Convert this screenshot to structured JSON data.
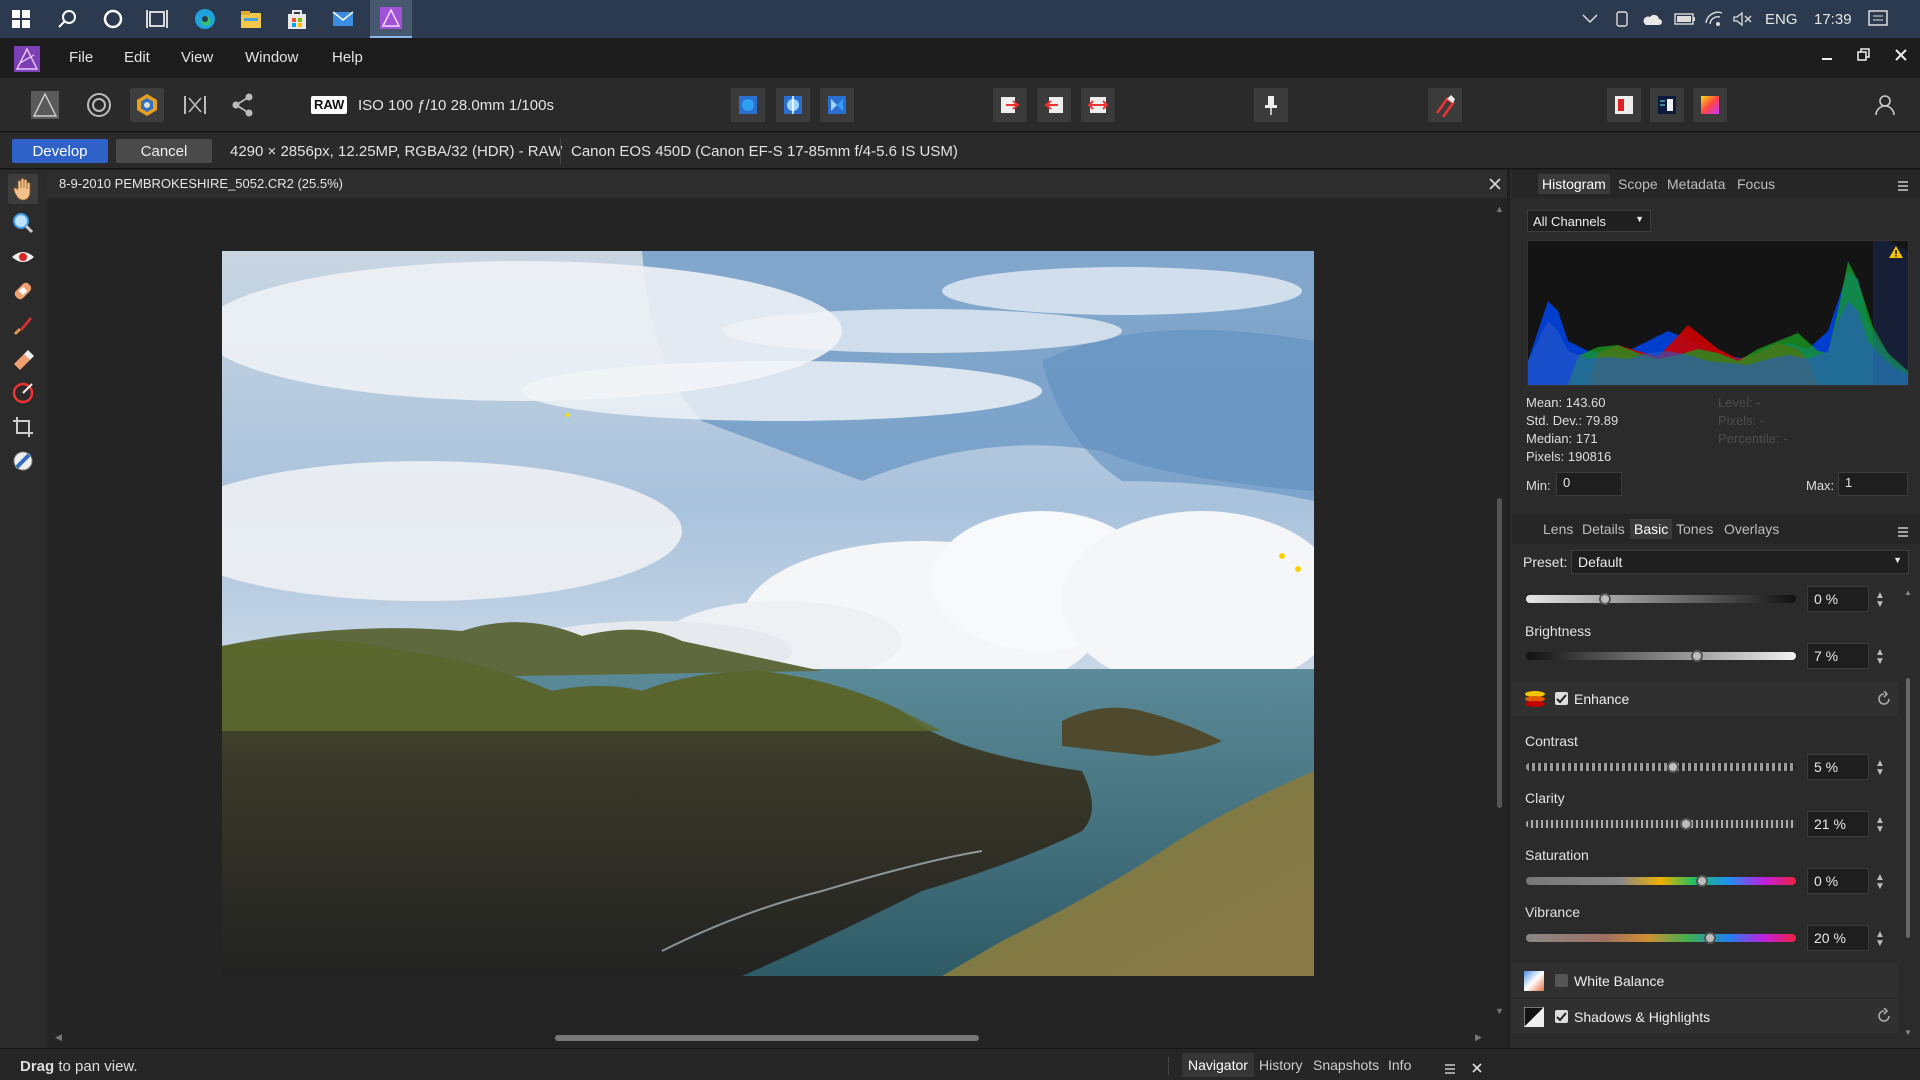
{
  "taskbar": {
    "language": "ENG",
    "time": "17:39"
  },
  "menu": {
    "items": [
      "File",
      "Edit",
      "View",
      "Window",
      "Help"
    ]
  },
  "toolbar": {
    "raw_badge": "RAW",
    "exif": "ISO 100 ƒ/10 28.0mm 1/100s"
  },
  "context": {
    "develop_label": "Develop",
    "cancel_label": "Cancel",
    "image_info": "4290 × 2856px, 12.25MP, RGBA/32 (HDR) - RAW",
    "camera_info": "Canon EOS 450D (Canon EF-S 17-85mm f/4-5.6 IS USM)"
  },
  "document": {
    "title": "8-9-2010 PEMBROKESHIRE_5052.CR2 (25.5%)"
  },
  "histogram_panel": {
    "tabs": [
      "Histogram",
      "Scope",
      "Metadata",
      "Focus"
    ],
    "active_tab": "Histogram",
    "channel": "All Channels",
    "stats": {
      "mean": "Mean: 143.60",
      "std_dev": "Std. Dev.: 79.89",
      "median": "Median: 171",
      "pixels": "Pixels: 190816"
    },
    "stats_dim": {
      "level": "Level: -",
      "pixels": "Pixels: -",
      "percentile": "Percentile: -"
    },
    "min_label": "Min:",
    "min_value": "0",
    "max_label": "Max:",
    "max_value": "1"
  },
  "develop_panel": {
    "tabs": [
      "Lens",
      "Details",
      "Basic",
      "Tones",
      "Overlays"
    ],
    "active_tab": "Basic",
    "preset_label": "Preset:",
    "preset_value": "Default",
    "sliders": [
      {
        "label": "",
        "value": "0 %",
        "position": 0.3
      },
      {
        "label": "Brightness",
        "value": "7 %",
        "position": 0.64
      },
      {
        "label": "Contrast",
        "value": "5 %",
        "position": 0.55
      },
      {
        "label": "Clarity",
        "value": "21 %",
        "position": 0.6
      },
      {
        "label": "Saturation",
        "value": "0 %",
        "position": 0.66
      },
      {
        "label": "Vibrance",
        "value": "20 %",
        "position": 0.69
      }
    ],
    "sections": {
      "enhance": {
        "label": "Enhance",
        "checked": true
      },
      "white_balance": {
        "label": "White Balance",
        "checked": false
      },
      "shadows_highlights": {
        "label": "Shadows & Highlights",
        "checked": true
      }
    }
  },
  "statusbar": {
    "hint_bold": "Drag",
    "hint_text": "to pan view.",
    "tabs": [
      "Navigator",
      "History",
      "Snapshots",
      "Info"
    ],
    "active_tab": "Navigator"
  },
  "colors": {
    "accent_blue": "#2e62c8",
    "panel_bg": "#2b2b2b",
    "canvas_bg": "#242424",
    "taskbar_bg": "#2c3a4f"
  }
}
